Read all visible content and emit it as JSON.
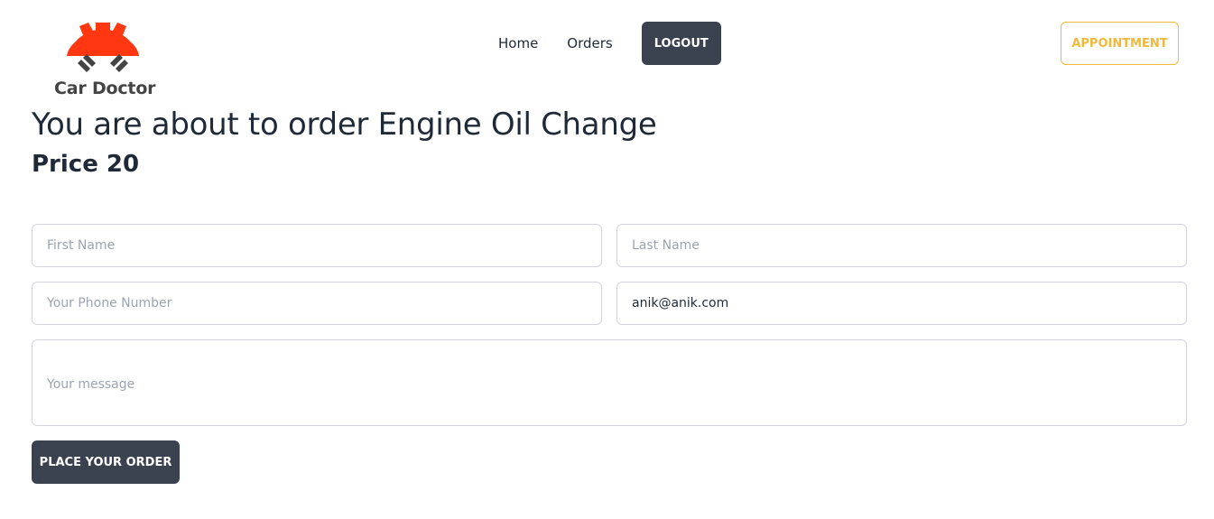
{
  "brand": {
    "name": "Car Doctor",
    "logo_icon": "gear-with-pistons-icon",
    "accent_color": "#ff3811"
  },
  "nav": {
    "links": [
      "Home",
      "Orders"
    ],
    "logout_label": "LOGOUT",
    "appointment_label": "APPOINTMENT"
  },
  "order": {
    "title": "You are about to order Engine Oil Change",
    "price": "Price 20"
  },
  "form": {
    "first_name_placeholder": "First Name",
    "last_name_placeholder": "Last Name",
    "phone_placeholder": "Your Phone Number",
    "email_value": "anik@anik.com",
    "message_placeholder": "Your message",
    "submit_label": "PLACE YOUR ORDER"
  },
  "colors": {
    "dark_button": "#3a4250",
    "appointment_outline": "#f0b93a"
  }
}
